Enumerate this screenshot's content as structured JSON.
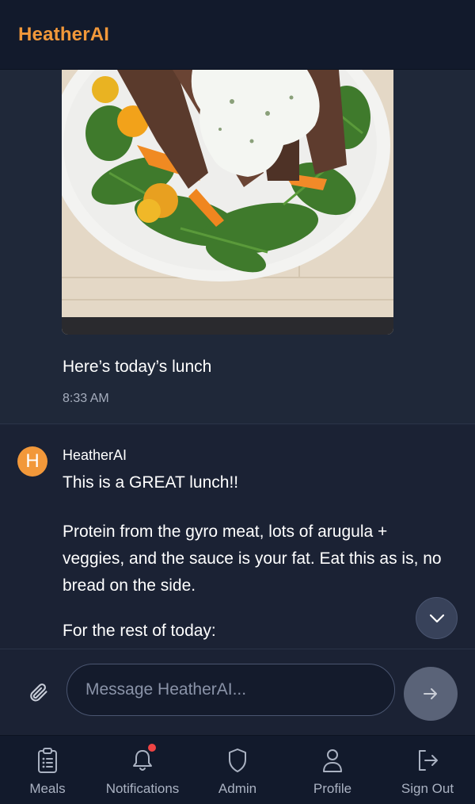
{
  "app": {
    "title": "HeatherAI"
  },
  "user_message": {
    "text": "Here’s today’s lunch",
    "time": "8:33 AM"
  },
  "ai_message": {
    "avatar_letter": "H",
    "name": "HeatherAI",
    "paragraphs": [
      "This is a GREAT lunch!!",
      "Protein from the gyro meat, lots of arugula + veggies, and the sauce is your fat. Eat this as is, no bread on the side.",
      "For the rest of today:"
    ]
  },
  "composer": {
    "placeholder": "Message HeatherAI..."
  },
  "nav": {
    "items": [
      {
        "label": "Meals",
        "icon": "clipboard-icon"
      },
      {
        "label": "Notifications",
        "icon": "bell-icon"
      },
      {
        "label": "Admin",
        "icon": "shield-icon"
      },
      {
        "label": "Profile",
        "icon": "person-icon"
      },
      {
        "label": "Sign Out",
        "icon": "sign-out-icon"
      }
    ]
  },
  "colors": {
    "brand": "#f2983a",
    "background": "#1d2538",
    "header": "#121a2c",
    "notification_dot": "#ef4444"
  }
}
